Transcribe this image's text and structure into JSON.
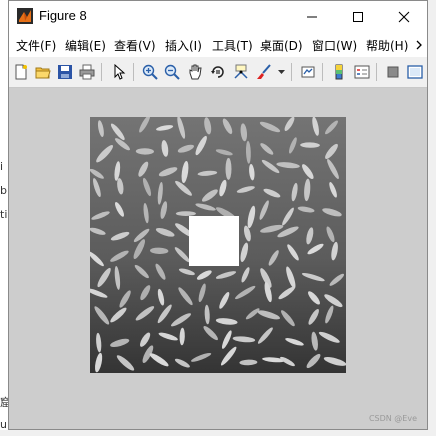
{
  "window": {
    "title": "Figure 8",
    "minimize_icon": "minimize-icon",
    "maximize_icon": "maximize-icon",
    "close_icon": "close-icon"
  },
  "menubar": {
    "items": [
      {
        "label": "文件(F)"
      },
      {
        "label": "编辑(E)"
      },
      {
        "label": "查看(V)"
      },
      {
        "label": "插入(I)"
      },
      {
        "label": "工具(T)"
      },
      {
        "label": "桌面(D)"
      },
      {
        "label": "窗口(W)"
      },
      {
        "label": "帮助(H)"
      }
    ],
    "overflow_icon": "chevron-right-icon"
  },
  "toolbar": {
    "buttons": [
      "new-figure-icon",
      "open-icon",
      "save-icon",
      "print-icon",
      "edit-plot-arrow-icon",
      "zoom-in-icon",
      "zoom-out-icon",
      "pan-hand-icon",
      "rotate-3d-icon",
      "data-cursor-icon",
      "brush-icon",
      "link-plot-icon",
      "colorbar-icon",
      "legend-icon",
      "hide-plot-tools-icon",
      "show-plot-tools-icon"
    ]
  },
  "figure": {
    "image_desc_icon": "grayscale-rice-image",
    "background": "#cdcdcd"
  },
  "background_app": {
    "left_texts": [
      "i",
      "b",
      "ti",
      "窟",
      "u"
    ]
  },
  "watermark": "CSDN @Eve"
}
